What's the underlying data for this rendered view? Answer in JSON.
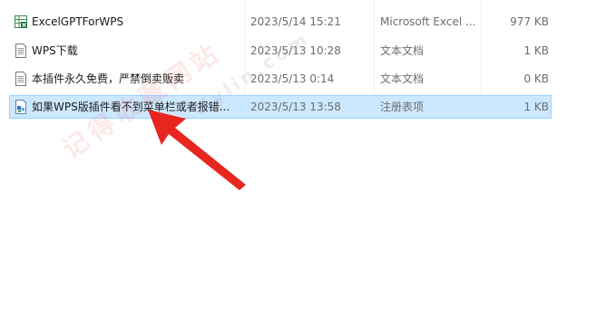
{
  "files": [
    {
      "name": "ExcelGPTForWPS",
      "date": "2023/5/14 15:21",
      "type": "Microsoft Excel ...",
      "size": "977 KB",
      "icon": "excel-addin-icon",
      "selected": false
    },
    {
      "name": "WPS下载",
      "date": "2023/5/13 10:28",
      "type": "文本文档",
      "size": "1 KB",
      "icon": "text-file-icon",
      "selected": false
    },
    {
      "name": "本插件永久免费，严禁倒卖贩卖",
      "date": "2023/5/13 0:14",
      "type": "文本文档",
      "size": "0 KB",
      "icon": "text-file-icon",
      "selected": false
    },
    {
      "name": "如果WPS版插件看不到菜单栏或者报错...",
      "date": "2023/5/13 13:58",
      "type": "注册表项",
      "size": "1 KB",
      "icon": "registry-file-icon",
      "selected": true
    }
  ],
  "watermark": {
    "text": "记得收藏网站",
    "subtext": "Hylin.com"
  },
  "colors": {
    "selection": "#cce8ff",
    "selection_border": "#99d1ff",
    "arrow": "#e8251f"
  }
}
